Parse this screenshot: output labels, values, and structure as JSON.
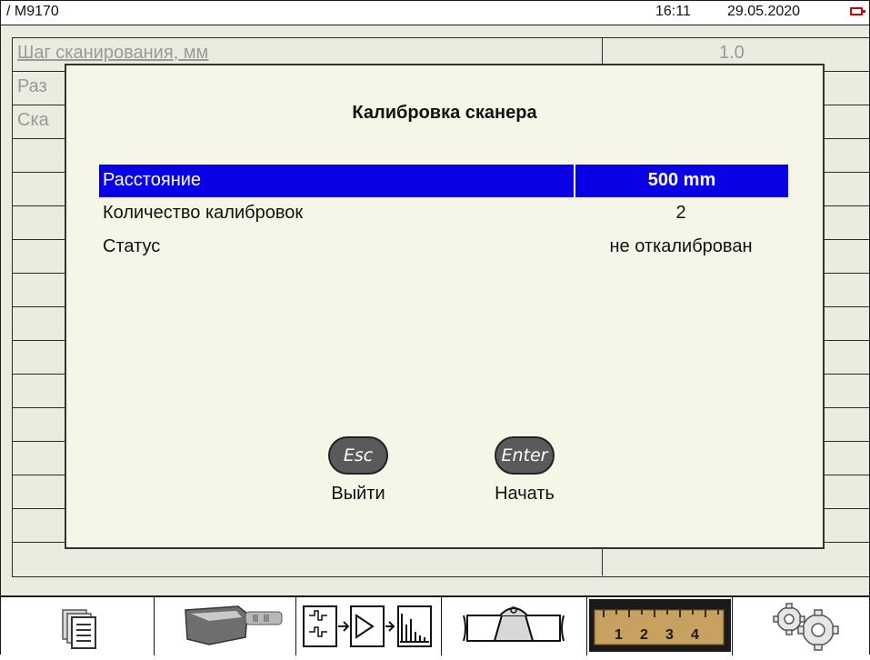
{
  "statusbar": {
    "title": "/ M9170",
    "time": "16:11",
    "date": "29.05.2020"
  },
  "background_table": {
    "rows": [
      {
        "label": "Шаг сканирования, мм",
        "value": "1.0"
      },
      {
        "label": "Раз",
        "value": ""
      },
      {
        "label": "Ска",
        "value": ""
      }
    ]
  },
  "dialog": {
    "title": "Калибровка сканера",
    "params": [
      {
        "label": "Расстояние",
        "value": "500 mm"
      },
      {
        "label": "Количество калибровок",
        "value": "2"
      },
      {
        "label": "Статус",
        "value": "не откалиброван"
      }
    ],
    "esc_key": "Esc",
    "esc_label": "Выйти",
    "enter_key": "Enter",
    "enter_label": "Начать"
  },
  "toolbar": {
    "items": [
      "documents-icon",
      "probe-icon",
      "signal-processing-icon",
      "weld-icon",
      "ruler-icon",
      "settings-gears-icon"
    ],
    "ruler_marks": "1 2 3 4"
  },
  "colors": {
    "selection": "#0a00e6",
    "battery": "#d10000",
    "dialog_bg": "#f6f6e8",
    "ruler": "#c8a060"
  }
}
